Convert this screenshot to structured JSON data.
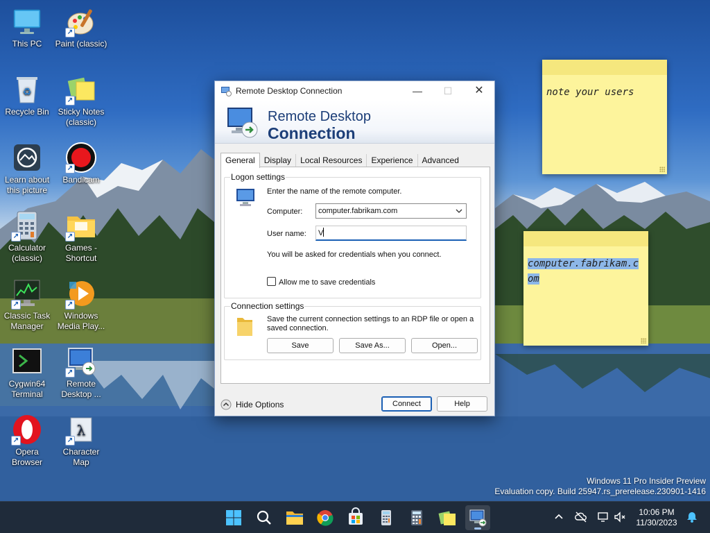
{
  "desktop": {
    "icons": [
      {
        "label": "This PC"
      },
      {
        "label": "Paint (classic)"
      },
      {
        "label": "Recycle Bin"
      },
      {
        "label": "Sticky Notes (classic)"
      },
      {
        "label": "Learn about this picture"
      },
      {
        "label": "Bandicam"
      },
      {
        "label": "Calculator (classic)"
      },
      {
        "label": "Games - Shortcut"
      },
      {
        "label": "Classic Task Manager"
      },
      {
        "label": "Windows Media Play..."
      },
      {
        "label": "Cygwin64 Terminal"
      },
      {
        "label": "Remote Desktop ..."
      },
      {
        "label": "Opera Browser"
      },
      {
        "label": "Character Map"
      }
    ],
    "sticky_notes": [
      {
        "text": "note your users"
      },
      {
        "text": "computer.fabrikam.com"
      }
    ],
    "watermark": {
      "line1": "Windows 11 Pro Insider Preview",
      "line2": "Evaluation copy. Build 25947.rs_prerelease.230901-1416"
    }
  },
  "rdc_window": {
    "title": "Remote Desktop Connection",
    "banner_line1": "Remote Desktop",
    "banner_line2": "Connection",
    "tabs": [
      {
        "label": "General"
      },
      {
        "label": "Display"
      },
      {
        "label": "Local Resources"
      },
      {
        "label": "Experience"
      },
      {
        "label": "Advanced"
      }
    ],
    "logon": {
      "group_label": "Logon settings",
      "instruction": "Enter the name of the remote computer.",
      "computer_label": "Computer:",
      "computer_value": "computer.fabrikam.com",
      "username_label": "User name:",
      "username_value": "V",
      "credentials_note": "You will be asked for credentials when you connect.",
      "save_credentials_label": "Allow me to save credentials"
    },
    "connection": {
      "group_label": "Connection settings",
      "description": "Save the current connection settings to an RDP file or open a saved connection.",
      "save_label": "Save",
      "save_as_label": "Save As...",
      "open_label": "Open..."
    },
    "footer": {
      "hide_options_label": "Hide Options",
      "connect_label": "Connect",
      "help_label": "Help"
    }
  },
  "taskbar": {
    "time": "10:06 PM",
    "date": "11/30/2023"
  },
  "colors": {
    "accent": "#1a5fb4",
    "taskbar_bg": "#1f2b3a",
    "sticky_yellow": "#fdf49c"
  }
}
